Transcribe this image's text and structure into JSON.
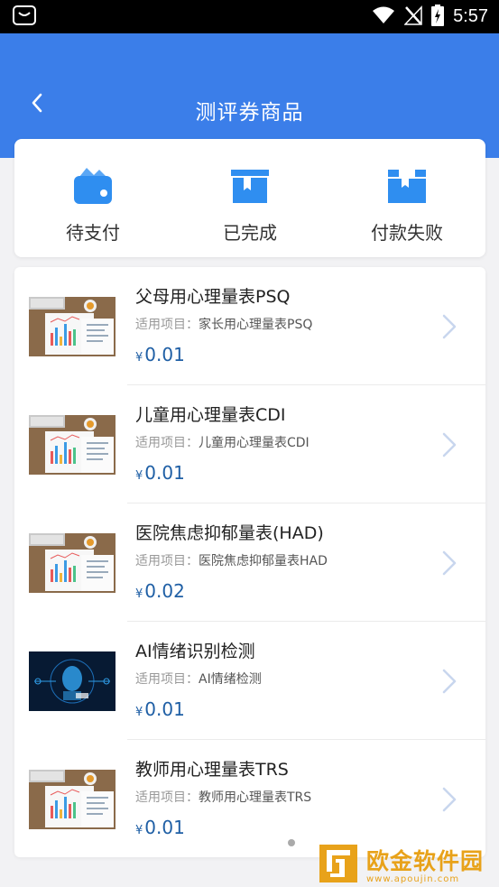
{
  "status_bar": {
    "time": "5:57",
    "icons": [
      "bag-icon",
      "wifi-icon",
      "no-signal-icon",
      "battery-charging-icon"
    ]
  },
  "header": {
    "title": "测评券商品",
    "back_icon": "chevron-left-icon",
    "background_color": "#3b7ee9"
  },
  "tabs": [
    {
      "label": "待支付",
      "icon": "wallet-icon"
    },
    {
      "label": "已完成",
      "icon": "box-icon"
    },
    {
      "label": "付款失败",
      "icon": "box-open-icon"
    }
  ],
  "products": [
    {
      "title": "父母用心理量表PSQ",
      "sub_label": "适用项目：",
      "sub_value": "家长用心理量表PSQ",
      "currency": "¥",
      "price": "0.01",
      "thumb": "chart-report-image"
    },
    {
      "title": "儿童用心理量表CDI",
      "sub_label": "适用项目：",
      "sub_value": "儿童用心理量表CDI",
      "currency": "¥",
      "price": "0.01",
      "thumb": "chart-report-image"
    },
    {
      "title": "医院焦虑抑郁量表(HAD)",
      "sub_label": "适用项目：",
      "sub_value": "医院焦虑抑郁量表HAD",
      "currency": "¥",
      "price": "0.02",
      "thumb": "chart-report-image"
    },
    {
      "title": "AI情绪识别检测",
      "sub_label": "适用项目：",
      "sub_value": "AI情绪检测",
      "currency": "¥",
      "price": "0.01",
      "thumb": "ai-face-scan-image"
    },
    {
      "title": "教师用心理量表TRS",
      "sub_label": "适用项目：",
      "sub_value": "教师用心理量表TRS",
      "currency": "¥",
      "price": "0.01",
      "thumb": "chart-report-image"
    }
  ],
  "watermark": {
    "name": "欧金软件园",
    "url": "www.apoujin.com"
  }
}
